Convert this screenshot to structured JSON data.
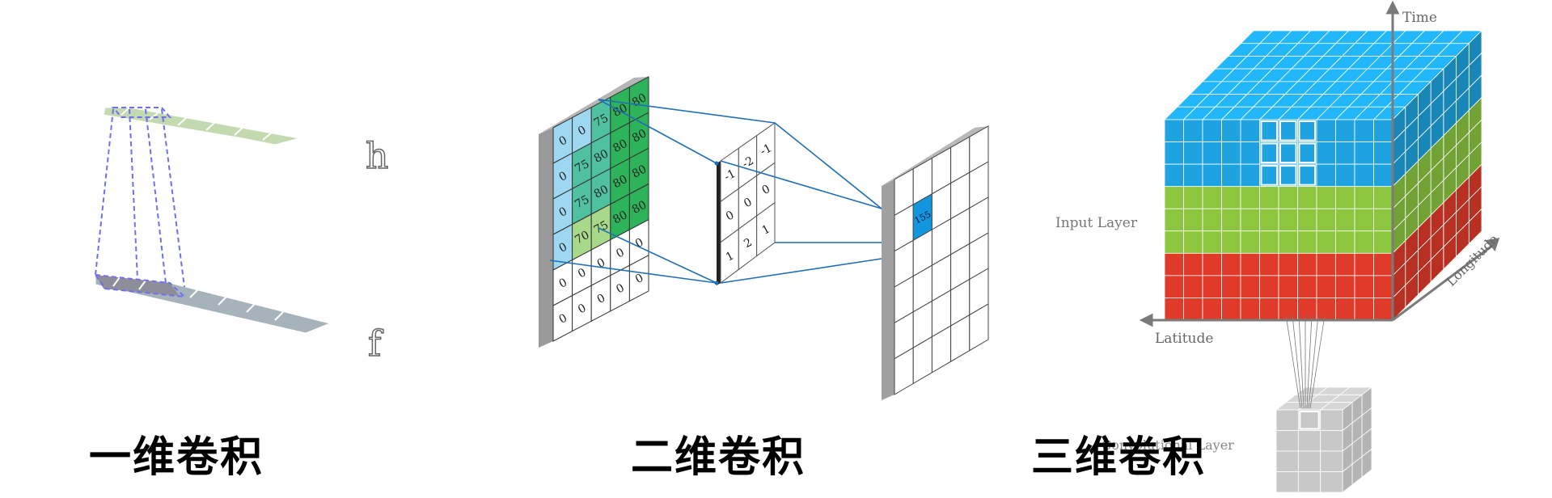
{
  "panels": [
    {
      "caption": "一维卷积",
      "labels": {
        "top": "h",
        "bottom": "f"
      }
    },
    {
      "caption": "二维卷积",
      "input_grid": [
        [
          "0",
          "0",
          "75",
          "80",
          "80"
        ],
        [
          "0",
          "75",
          "80",
          "80",
          "80"
        ],
        [
          "0",
          "75",
          "80",
          "80",
          "80"
        ],
        [
          "0",
          "70",
          "75",
          "80",
          "80"
        ],
        [
          "0",
          "0",
          "0",
          "0",
          "0"
        ],
        [
          "0",
          "0",
          "0",
          "0",
          "0"
        ]
      ],
      "kernel": [
        [
          "-1",
          "-2",
          "-1"
        ],
        [
          "0",
          "0",
          "0"
        ],
        [
          "1",
          "2",
          "1"
        ]
      ],
      "output_value": "155"
    },
    {
      "caption": "三维卷积",
      "axis_labels": {
        "time": "Time",
        "latitude": "Latitude",
        "longitude": "Longitude"
      },
      "layer_labels": {
        "input": "Input Layer",
        "conv": "Convolutional Layer"
      }
    }
  ],
  "colors": {
    "dashed_outline": "#6f6ff0",
    "strip_top": "#b9d5a5",
    "strip_bottom": "#9aa9b3",
    "cube_blue": "#1ea3e0",
    "cube_green": "#8cc63f",
    "cube_red": "#e03a2a",
    "cube_gray": "#c8c8c8",
    "grid_light_blue": "#9ed8f0",
    "grid_teal": "#4fc0a0",
    "grid_green": "#2db35a",
    "grid_light_green": "#a8d88a",
    "output_blue": "#1296e0",
    "connector": "#1f6fb5"
  }
}
